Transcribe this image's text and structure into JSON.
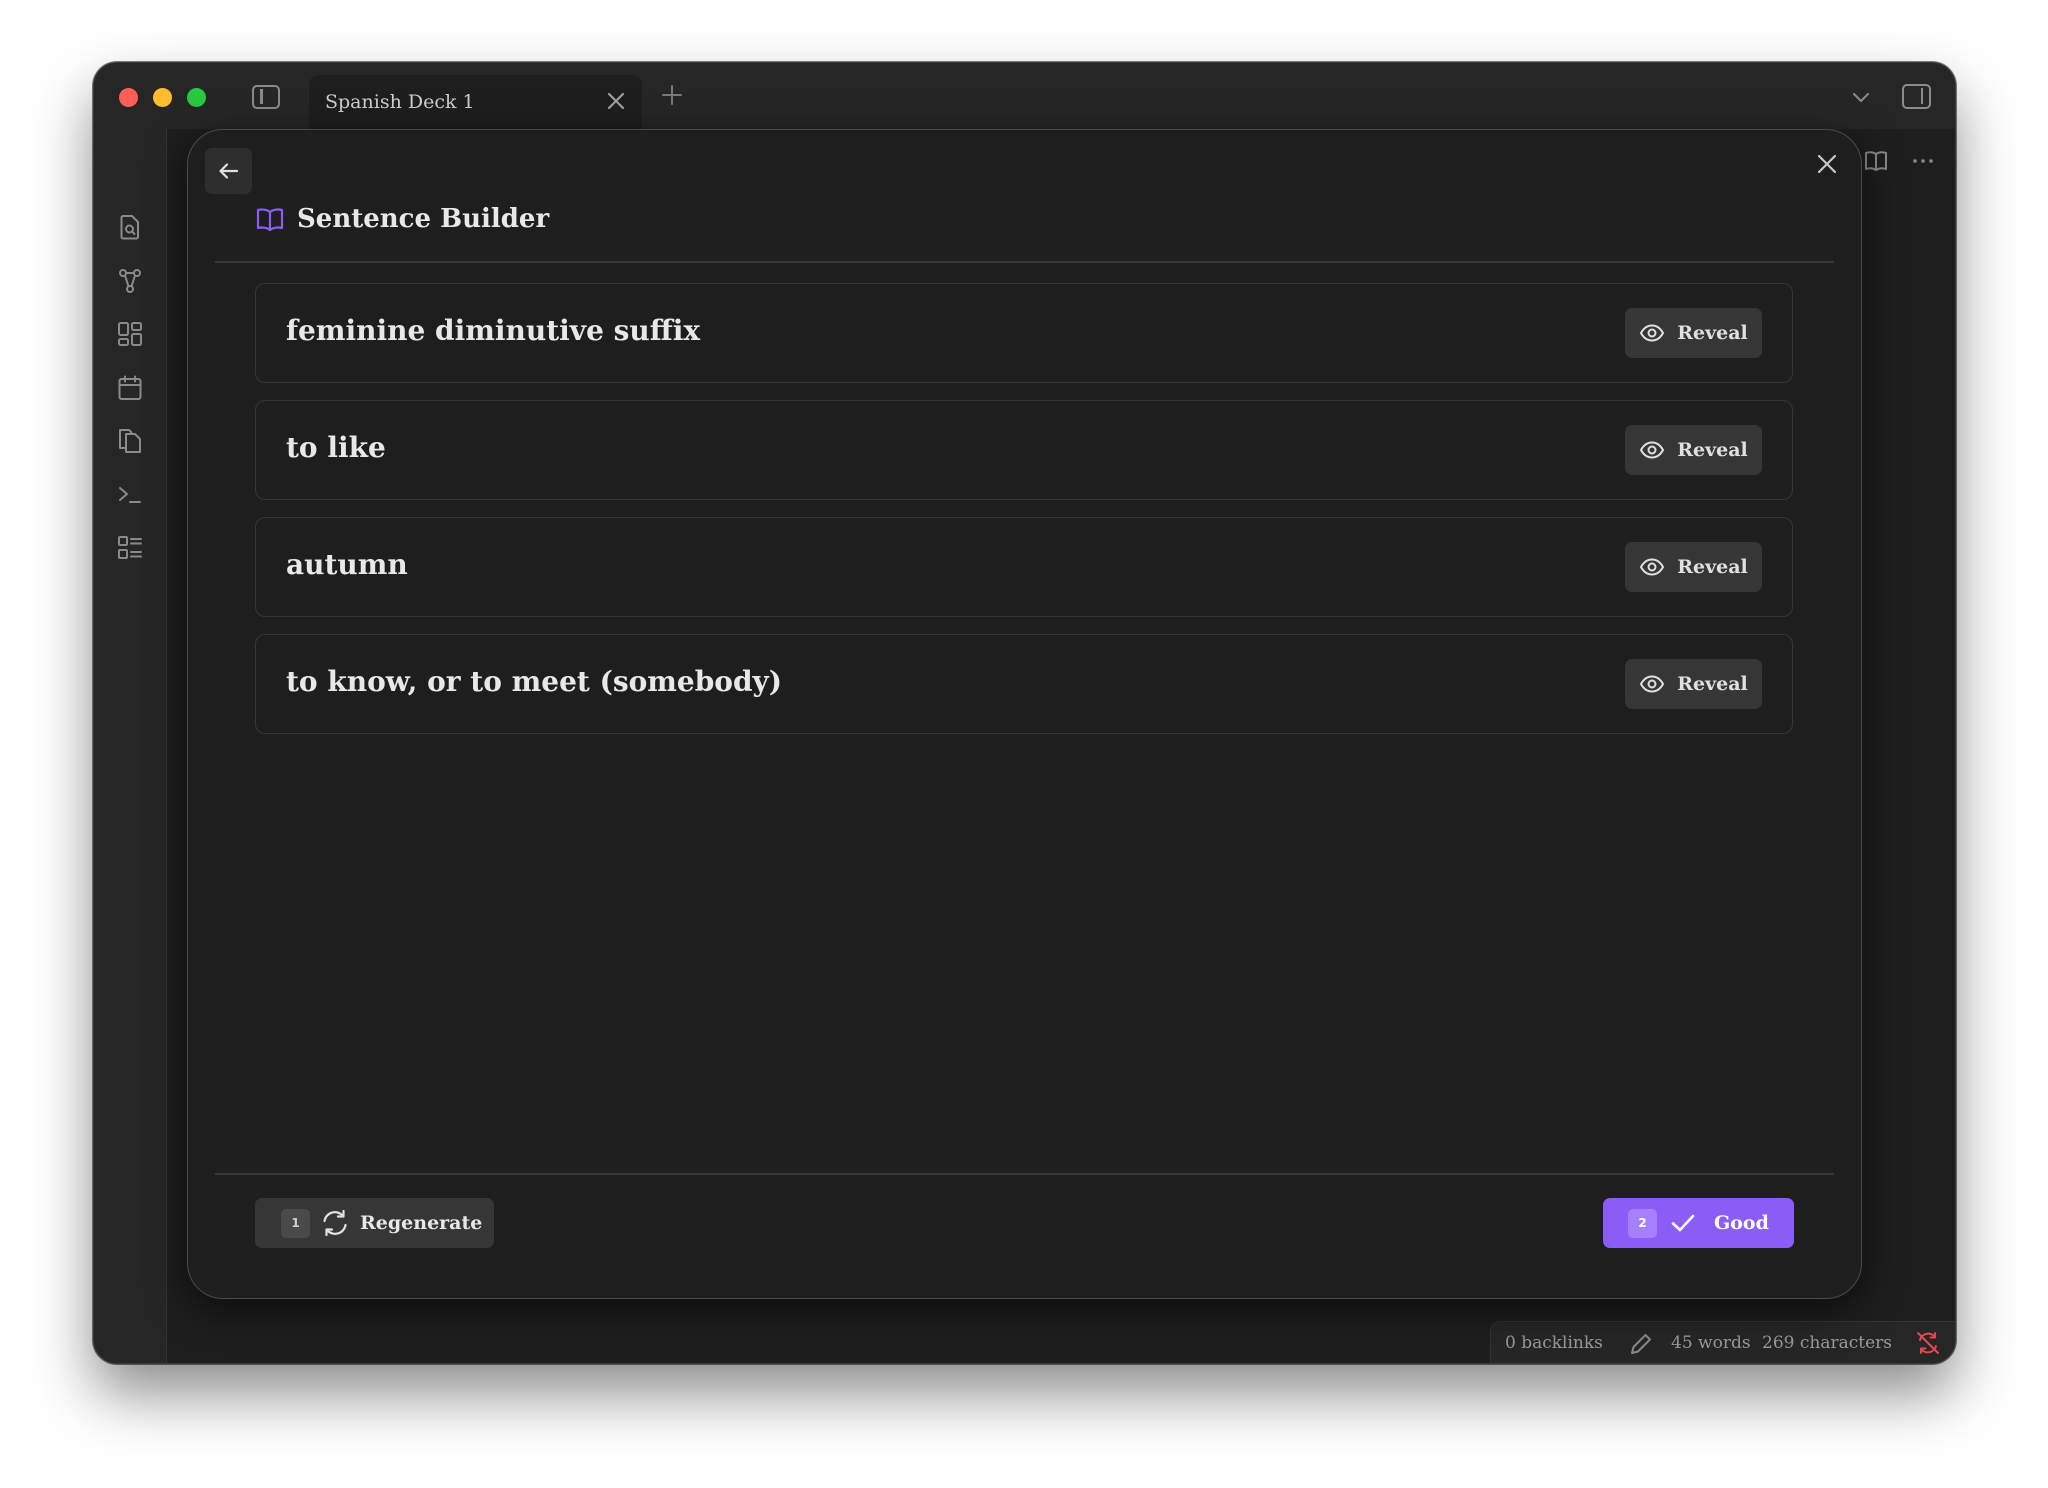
{
  "window": {
    "tab_title": "Spanish Deck 1"
  },
  "ribbon": {
    "icons": [
      "search-file-icon",
      "graph-icon",
      "grid-icon",
      "calendar-icon",
      "copy-icon",
      "terminal-icon",
      "list-icon"
    ]
  },
  "modal": {
    "title": "Sentence Builder",
    "cards": [
      {
        "prompt": "feminine diminutive suffix",
        "reveal_label": "Reveal"
      },
      {
        "prompt": "to like",
        "reveal_label": "Reveal"
      },
      {
        "prompt": "autumn",
        "reveal_label": "Reveal"
      },
      {
        "prompt": "to know, or to meet (somebody)",
        "reveal_label": "Reveal"
      }
    ],
    "regenerate": {
      "shortcut": "1",
      "label": "Regenerate"
    },
    "good": {
      "shortcut": "2",
      "label": "Good"
    }
  },
  "statusbar": {
    "backlinks": "0 backlinks",
    "words": "45 words",
    "characters": "269 characters"
  },
  "colors": {
    "accent": "#8b5cf6",
    "background": "#1e1e1e",
    "sync_error": "#e5484d"
  }
}
